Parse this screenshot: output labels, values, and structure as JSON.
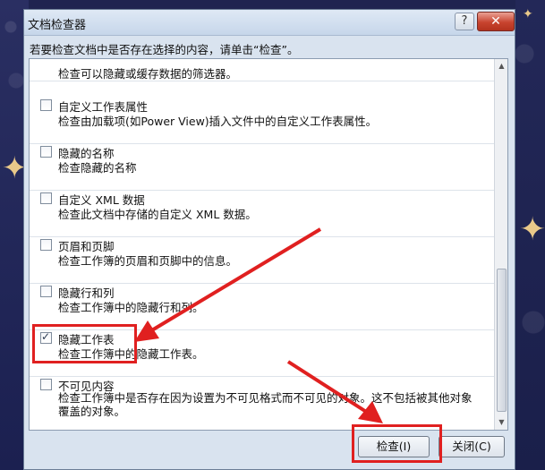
{
  "window": {
    "title": "文档检查器",
    "help_label": "?",
    "close_label": "✕"
  },
  "instruction": "若要检查文档中是否存在选择的内容，请单击“检查”。",
  "items": [
    {
      "title": "",
      "desc": "检查可以隐藏或缓存数据的筛选器。",
      "checked": false
    },
    {
      "title": "自定义工作表属性",
      "desc": "检查由加载项(如Power View)插入文件中的自定义工作表属性。",
      "checked": false
    },
    {
      "title": "隐藏的名称",
      "desc": "检查隐藏的名称",
      "checked": false
    },
    {
      "title": "自定义 XML 数据",
      "desc": "检查此文档中存储的自定义 XML 数据。",
      "checked": false
    },
    {
      "title": "页眉和页脚",
      "desc": "检查工作簿的页眉和页脚中的信息。",
      "checked": false
    },
    {
      "title": "隐藏行和列",
      "desc": "检查工作簿中的隐藏行和列。",
      "checked": false
    },
    {
      "title": "隐藏工作表",
      "desc": "检查工作簿中的隐藏工作表。",
      "checked": true
    },
    {
      "title": "不可见内容",
      "desc": "检查工作簿中是否存在因为设置为不可见格式而不可见的对象。这不包括被其他对象覆盖的对象。",
      "checked": false
    }
  ],
  "buttons": {
    "inspect": "检查(I)",
    "close": "关闭(C)"
  },
  "colors": {
    "annotation_red": "#e02020",
    "background_navy": "#1f2450",
    "dialog_bg": "#d9e3ef"
  }
}
